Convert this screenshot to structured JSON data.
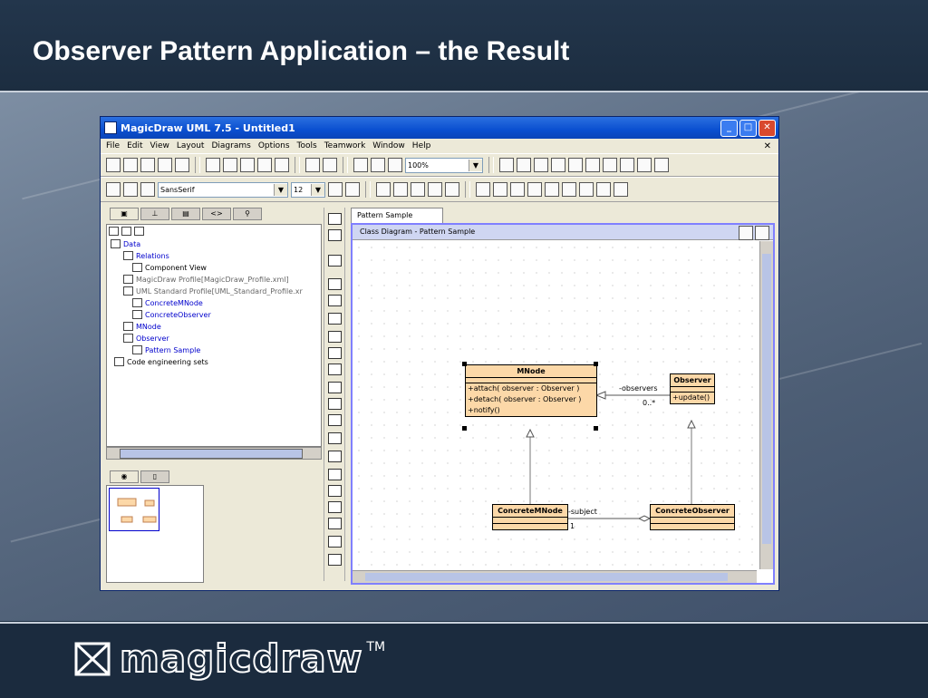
{
  "slide": {
    "title": "Observer Pattern Application – the Result",
    "logo_text": "magicdraw",
    "trademark": "TM"
  },
  "window": {
    "title": "MagicDraw UML 7.5 - Untitled1",
    "buttons": {
      "minimize": "_",
      "maximize": "□",
      "close": "✕"
    }
  },
  "menu": {
    "items": [
      "File",
      "Edit",
      "View",
      "Layout",
      "Diagrams",
      "Options",
      "Tools",
      "Teamwork",
      "Window",
      "Help"
    ],
    "close_glyph": "✕"
  },
  "toolbar": {
    "zoom": "100%",
    "font": "SansSerif",
    "font_size": "12"
  },
  "tree": {
    "items": [
      {
        "label": "Data",
        "color": "#0000cc"
      },
      {
        "label": "Relations",
        "color": "#0000cc"
      },
      {
        "label": "Component View",
        "color": "#000000"
      },
      {
        "label": "MagicDraw Profile[MagicDraw_Profile.xml]",
        "color": "#666666"
      },
      {
        "label": "UML Standard Profile[UML_Standard_Profile.xr",
        "color": "#666666"
      },
      {
        "label": "ConcreteMNode",
        "color": "#0000cc"
      },
      {
        "label": "ConcreteObserver",
        "color": "#0000cc"
      },
      {
        "label": "MNode",
        "color": "#0000cc"
      },
      {
        "label": "Observer",
        "color": "#0000cc"
      },
      {
        "label": "Pattern Sample",
        "color": "#0000cc"
      },
      {
        "label": "Code engineering sets",
        "color": "#000000"
      }
    ]
  },
  "diagram": {
    "tab_label": "Pattern Sample",
    "title": "Class Diagram - Pattern Sample",
    "classes": {
      "mnode": {
        "name": "MNode",
        "operations": [
          "+attach( observer : Observer )",
          "+detach( observer : Observer )",
          "+notify()"
        ]
      },
      "observer": {
        "name": "Observer",
        "operations": [
          "+update()"
        ]
      },
      "concrete_mnode": {
        "name": "ConcreteMNode"
      },
      "concrete_observer": {
        "name": "ConcreteObserver"
      }
    },
    "associations": {
      "observers_role": "-observers",
      "observers_mult": "0..*",
      "subject_role": "-subject",
      "subject_mult": "1"
    }
  },
  "colors": {
    "class_fill": "#fcd8a8",
    "title_bar": "#0a4fd0",
    "slide_header": "#1f3145"
  }
}
